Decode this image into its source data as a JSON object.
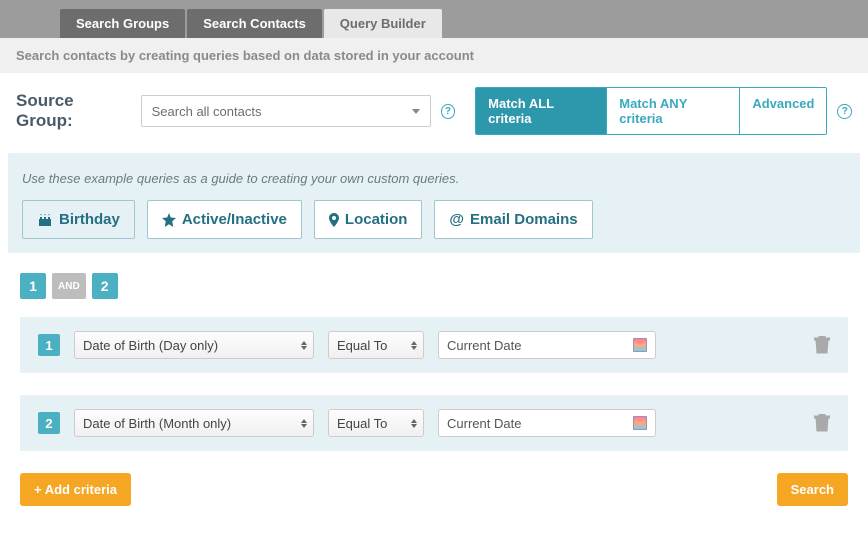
{
  "tabs": {
    "search_groups": "Search Groups",
    "search_contacts": "Search Contacts",
    "query_builder": "Query Builder"
  },
  "description": "Search contacts by creating queries based on data stored in your account",
  "source": {
    "label": "Source Group:",
    "selected": "Search all contacts"
  },
  "criteria_toggle": {
    "all": "Match ALL criteria",
    "any": "Match ANY criteria",
    "advanced": "Advanced"
  },
  "panel": {
    "hint": "Use these example queries as a guide to creating your own custom queries.",
    "examples": {
      "birthday": "Birthday",
      "active": "Active/Inactive",
      "location": "Location",
      "email": "Email Domains"
    }
  },
  "logic": {
    "one": "1",
    "and": "AND",
    "two": "2"
  },
  "rows": [
    {
      "num": "1",
      "field": "Date of Birth (Day only)",
      "op": "Equal To",
      "value": "Current Date"
    },
    {
      "num": "2",
      "field": "Date of Birth (Month only)",
      "op": "Equal To",
      "value": "Current Date"
    }
  ],
  "buttons": {
    "add": "+ Add criteria",
    "search": "Search"
  }
}
